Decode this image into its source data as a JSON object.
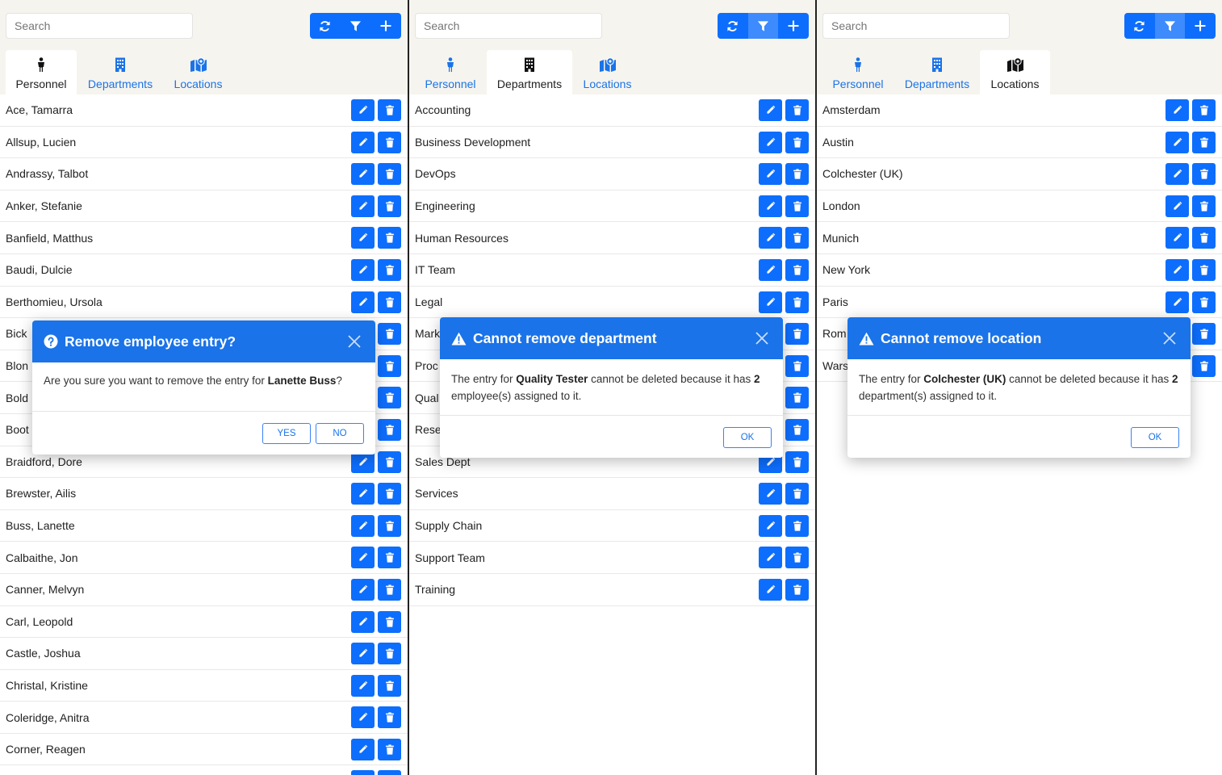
{
  "search_placeholder": "Search",
  "tabs": {
    "personnel": "Personnel",
    "departments": "Departments",
    "locations": "Locations"
  },
  "personnel": {
    "rows": [
      "Ace, Tamarra",
      "Allsup, Lucien",
      "Andrassy, Talbot",
      "Anker, Stefanie",
      "Banfield, Matthus",
      "Baudi, Dulcie",
      "Berthomieu, Ursola",
      "Bick",
      "Blon",
      "Bold",
      "Boot",
      "Braidford, Dore",
      "Brewster, Ailis",
      "Buss, Lanette",
      "Calbaithe, Jon",
      "Canner, Melvyn",
      "Carl, Leopold",
      "Castle, Joshua",
      "Christal, Kristine",
      "Coleridge, Anitra",
      "Corner, Reagen",
      ""
    ],
    "modal": {
      "title": "Remove employee entry?",
      "body_prefix": "Are you sure you want to remove the entry for ",
      "body_name": "Lanette Buss",
      "body_suffix": "?",
      "yes": "YES",
      "no": "NO"
    }
  },
  "departments": {
    "rows": [
      "Accounting",
      "Business Development",
      "DevOps",
      "Engineering",
      "Human Resources",
      "IT Team",
      "Legal",
      "Mark",
      "Proc",
      "Qual",
      "Rese",
      "Sales Dept",
      "Services",
      "Supply Chain",
      "Support Team",
      "Training"
    ],
    "modal": {
      "title": "Cannot remove department",
      "body_prefix": "The entry for ",
      "body_name": "Quality Tester",
      "body_mid": " cannot be deleted because it has ",
      "body_count": "2",
      "body_suffix": "employee(s) assigned to it.",
      "ok": "OK"
    }
  },
  "locations": {
    "rows": [
      "Amsterdam",
      "Austin",
      "Colchester (UK)",
      "London",
      "Munich",
      "New York",
      "Paris",
      "Rom",
      "Wars"
    ],
    "modal": {
      "title": "Cannot remove location",
      "body_prefix": "The entry for ",
      "body_name": "Colchester (UK)",
      "body_mid": " cannot be deleted because it has ",
      "body_count": "2",
      "body_suffix": "department(s) assigned to it.",
      "ok": "OK"
    }
  },
  "colors": {
    "primary": "#0d6efd",
    "header": "#1a73e8",
    "topbar": "#f6f4ee"
  }
}
